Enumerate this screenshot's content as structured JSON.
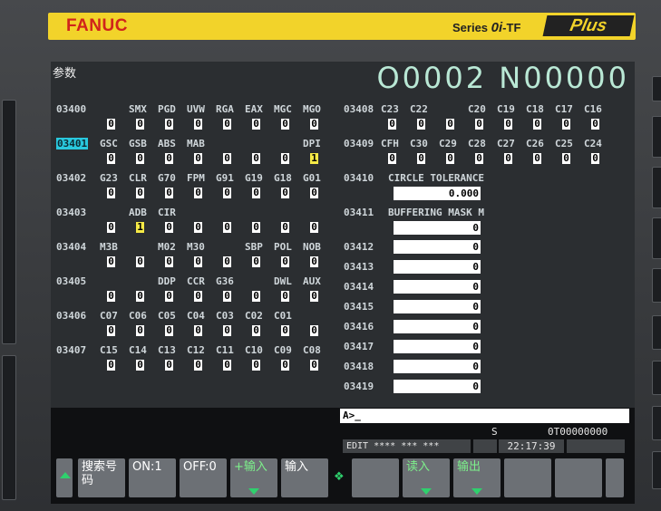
{
  "brand": {
    "name": "FANUC",
    "series_prefix": "Series ",
    "series_model": "0i",
    "series_suffix": "-TF",
    "plus": "Plus"
  },
  "header": {
    "title": "参数",
    "program": "O0002 N00000"
  },
  "left_params": [
    {
      "number": "03400",
      "labels": [
        "",
        "SMX",
        "PGD",
        "UVW",
        "RGA",
        "EAX",
        "MGC",
        "MGO"
      ],
      "bits": [
        "0",
        "0",
        "0",
        "0",
        "0",
        "0",
        "0",
        "0"
      ]
    },
    {
      "number": "03401",
      "labels": [
        "GSC",
        "GSB",
        "ABS",
        "MAB",
        "",
        "",
        "",
        "DPI"
      ],
      "bits": [
        "0",
        "0",
        "0",
        "0",
        "0",
        "0",
        "0",
        "1"
      ],
      "selected": true
    },
    {
      "number": "03402",
      "labels": [
        "G23",
        "CLR",
        "G70",
        "FPM",
        "G91",
        "G19",
        "G18",
        "G01"
      ],
      "bits": [
        "0",
        "0",
        "0",
        "0",
        "0",
        "0",
        "0",
        "0"
      ]
    },
    {
      "number": "03403",
      "labels": [
        "",
        "ADB",
        "CIR",
        "",
        "",
        "",
        "",
        ""
      ],
      "bits": [
        "0",
        "1",
        "0",
        "0",
        "0",
        "0",
        "0",
        "0"
      ]
    },
    {
      "number": "03404",
      "labels": [
        "M3B",
        "",
        "M02",
        "M30",
        "",
        "SBP",
        "POL",
        "NOB"
      ],
      "bits": [
        "0",
        "0",
        "0",
        "0",
        "0",
        "0",
        "0",
        "0"
      ]
    },
    {
      "number": "03405",
      "labels": [
        "",
        "",
        "DDP",
        "CCR",
        "G36",
        "",
        "DWL",
        "AUX"
      ],
      "bits": [
        "0",
        "0",
        "0",
        "0",
        "0",
        "0",
        "0",
        "0"
      ]
    },
    {
      "number": "03406",
      "labels": [
        "C07",
        "C06",
        "C05",
        "C04",
        "C03",
        "C02",
        "C01",
        ""
      ],
      "bits": [
        "0",
        "0",
        "0",
        "0",
        "0",
        "0",
        "0",
        "0"
      ]
    },
    {
      "number": "03407",
      "labels": [
        "C15",
        "C14",
        "C13",
        "C12",
        "C11",
        "C10",
        "C09",
        "C08"
      ],
      "bits": [
        "0",
        "0",
        "0",
        "0",
        "0",
        "0",
        "0",
        "0"
      ]
    }
  ],
  "right_bit_params": [
    {
      "number": "03408",
      "labels": [
        "C23",
        "C22",
        "",
        "C20",
        "C19",
        "C18",
        "C17",
        "C16"
      ],
      "bits": [
        "0",
        "0",
        "0",
        "0",
        "0",
        "0",
        "0",
        "0"
      ]
    },
    {
      "number": "03409",
      "labels": [
        "CFH",
        "C30",
        "C29",
        "C28",
        "C27",
        "C26",
        "C25",
        "C24"
      ],
      "bits": [
        "0",
        "0",
        "0",
        "0",
        "0",
        "0",
        "0",
        "0"
      ]
    }
  ],
  "value_params": [
    {
      "number": "03410",
      "desc": "CIRCLE TOLERANCE",
      "value": "0.000"
    },
    {
      "number": "03411",
      "desc": "BUFFERING MASK M",
      "value": "0"
    },
    {
      "number": "03412",
      "desc": "",
      "value": "0"
    },
    {
      "number": "03413",
      "desc": "",
      "value": "0"
    },
    {
      "number": "03414",
      "desc": "",
      "value": "0"
    },
    {
      "number": "03415",
      "desc": "",
      "value": "0"
    },
    {
      "number": "03416",
      "desc": "",
      "value": "0"
    },
    {
      "number": "03417",
      "desc": "",
      "value": "0"
    },
    {
      "number": "03418",
      "desc": "",
      "value": "0"
    },
    {
      "number": "03419",
      "desc": "",
      "value": "0"
    }
  ],
  "command": {
    "prompt": "A>_"
  },
  "status": {
    "s": "S",
    "t": "0T00000000",
    "mode": "EDIT **** *** ***",
    "time": "22:17:39"
  },
  "softkeys": [
    {
      "label": "",
      "kind": "up"
    },
    {
      "label": "搜索号码",
      "kind": "plain"
    },
    {
      "label": "ON:1",
      "kind": "plain"
    },
    {
      "label": "OFF:0",
      "kind": "plain"
    },
    {
      "label": "+输入",
      "kind": "green-arrow"
    },
    {
      "label": "输入",
      "kind": "plain"
    },
    {
      "label": "",
      "kind": "next"
    },
    {
      "label": "",
      "kind": "plain"
    },
    {
      "label": "读入",
      "kind": "green-arrow"
    },
    {
      "label": "输出",
      "kind": "green-arrow"
    },
    {
      "label": "",
      "kind": "plain"
    },
    {
      "label": "",
      "kind": "plain"
    },
    {
      "label": "",
      "kind": "plain"
    }
  ],
  "colors": {
    "selected": "#29c8de",
    "on_bit": "#f6ea46",
    "brand_red": "#d0241b",
    "bezel_yellow": "#f2d32a"
  }
}
